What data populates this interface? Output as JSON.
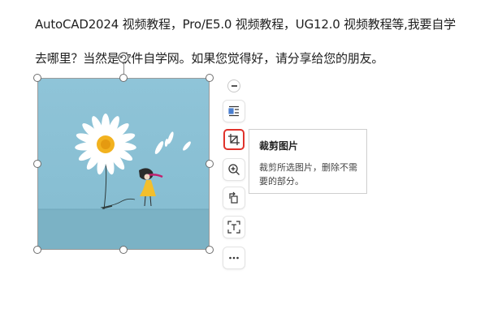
{
  "document": {
    "line1": "AutoCAD2024 视频教程，Pro/E5.0 视频教程，UG12.0 视频教程等,我要自学",
    "line2": "去哪里？当然是软件自学网。如果您觉得好，请分享给您的朋友。"
  },
  "toolbar": {
    "buttons": [
      {
        "name": "collapse",
        "icon": "minus-icon"
      },
      {
        "name": "wrap-text",
        "icon": "text-wrap-icon"
      },
      {
        "name": "crop",
        "icon": "crop-icon",
        "active": true
      },
      {
        "name": "zoom",
        "icon": "zoom-in-icon"
      },
      {
        "name": "rotate",
        "icon": "rotate-icon"
      },
      {
        "name": "extract-text",
        "icon": "ocr-scan-icon"
      },
      {
        "name": "more",
        "icon": "more-icon"
      }
    ]
  },
  "tooltip": {
    "title": "裁剪图片",
    "description": "裁剪所选图片，删除不需要的部分。"
  },
  "colors": {
    "accent_red": "#e0322b",
    "photo_sky": "#8fc3d6",
    "photo_floor": "#79b1c4"
  }
}
